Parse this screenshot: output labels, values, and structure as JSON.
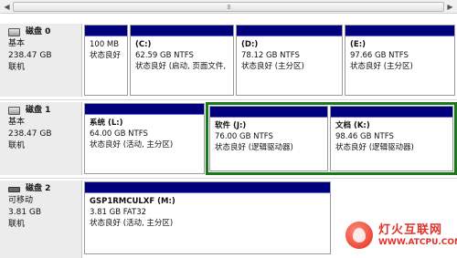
{
  "scrollbar": {
    "left_arrow": "◀",
    "right_arrow": "▶",
    "grip": "⁞⁞⁞"
  },
  "disks": [
    {
      "title": "磁盘 0",
      "type": "基本",
      "size": "238.47 GB",
      "status": "联机",
      "partitions": [
        {
          "name": "",
          "size_fs": "100 MB",
          "status": "状态良好"
        },
        {
          "name": "(C:)",
          "size_fs": "62.59 GB NTFS",
          "status": "状态良好 (启动, 页面文件,"
        },
        {
          "name": "(D:)",
          "size_fs": "78.12 GB NTFS",
          "status": "状态良好 (主分区)"
        },
        {
          "name": "(E:)",
          "size_fs": "97.66 GB NTFS",
          "status": "状态良好 (主分区)"
        }
      ]
    },
    {
      "title": "磁盘 1",
      "type": "基本",
      "size": "238.47 GB",
      "status": "联机",
      "partitions": [
        {
          "name": "系统  (L:)",
          "size_fs": "64.00 GB NTFS",
          "status": "状态良好 (活动, 主分区)"
        },
        {
          "name": "软件  (J:)",
          "size_fs": "76.00 GB NTFS",
          "status": "状态良好 (逻辑驱动器)"
        },
        {
          "name": "文档  (K:)",
          "size_fs": "98.46 GB NTFS",
          "status": "状态良好 (逻辑驱动器)"
        }
      ]
    },
    {
      "title": "磁盘 2",
      "type": "可移动",
      "size": "3.81 GB",
      "status": "联机",
      "partitions": [
        {
          "name": "GSP1RMCULXF  (M:)",
          "size_fs": "3.81 GB FAT32",
          "status": "状态良好 (活动, 主分区)"
        }
      ]
    }
  ],
  "watermark": {
    "cn": "灯火互联网",
    "url": "WWW.ATCPU.COM"
  },
  "colors": {
    "partition_bar": "#00007c",
    "selection": "#1a7a1a",
    "watermark": "#e0312a"
  }
}
